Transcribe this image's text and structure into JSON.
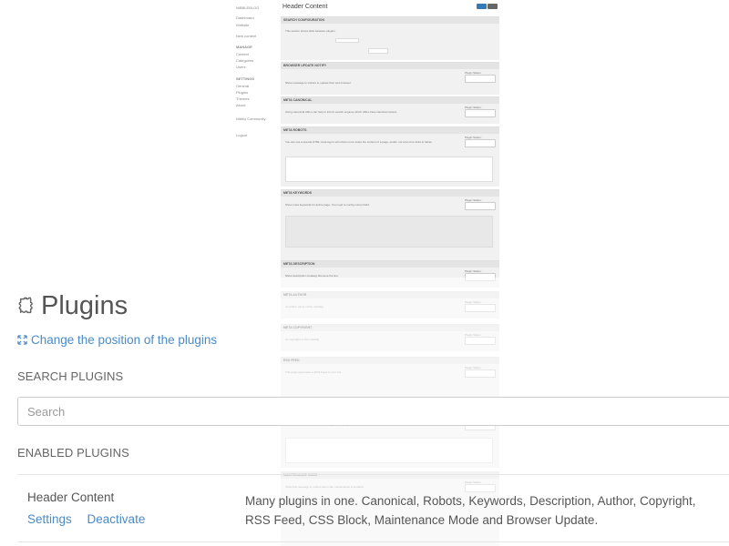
{
  "background": {
    "sidebar": {
      "brand": "NIBBLEBLOG",
      "items": [
        "Dashboard",
        "Website",
        "New content"
      ],
      "manage_label": "MANAGE",
      "manage_items": [
        "Content",
        "Categories",
        "Users"
      ],
      "settings_label": "SETTINGS",
      "settings_items": [
        "General",
        "Plugins",
        "Themes",
        "About"
      ],
      "extra": "Nibbly Community",
      "logout": "Logout"
    },
    "page": {
      "title": "Header Content",
      "sections": [
        {
          "title": "SEARCH CONFIGURATION",
          "desc": "This section shows links between plugins.",
          "status_label": "",
          "select": ""
        },
        {
          "title": "BROWSER UPDATE NOTIFY",
          "desc": "Show message to visitors to update their web browser.",
          "status_label": "Plugin Status:",
          "select": "Enabled"
        },
        {
          "title": "META CANONICAL",
          "desc": "Using canonical URLs can help to inform search engines which URLs have identical content.",
          "status_label": "Plugin Status:",
          "select": "Enabled"
        },
        {
          "title": "META ROBOTS",
          "desc": "You can use a special HTML meta tag to tell robots not to index the content of a page, and/or not scan it for links to follow.",
          "status_label": "Plugin Status:",
          "select": "Enabled"
        },
        {
          "title": "META KEYWORDS",
          "desc": "Show meta keywords for active page. You need to config current field.",
          "status_label": "Plugin Status:",
          "select": "Enabled"
        },
        {
          "title": "META DESCRIPTION",
          "desc": "Show description metatag. Remove the line",
          "status_label": "Plugin Status:",
          "select": "Enabled"
        },
        {
          "title": "META AUTHOR",
          "desc": "An author name of this metatag",
          "status_label": "Plugin Status:",
          "select": "Enabled"
        },
        {
          "title": "META COPYRIGHT",
          "desc": "An copyright of this metatag",
          "status_label": "Plugin Status:",
          "select": "Enabled"
        },
        {
          "title": "RSS FEED",
          "desc": "This plugin generates a RSS Feed of your site.",
          "status_label": "Plugin Status:",
          "select": "Enabled"
        },
        {
          "title": "CSS BLOCK",
          "desc": "Show this css code before html closing the head tag.",
          "status_label": "Plugin Status:",
          "select": "Enabled"
        },
        {
          "title": "MAINTENANCE MODE",
          "desc": "Show this message to visitors when site maintenance is enabled.",
          "status_label": "Plugin Status:",
          "select": "Enabled"
        }
      ]
    }
  },
  "plugins_page": {
    "title": "Plugins",
    "change_position": "Change the position of the plugins",
    "search_heading": "SEARCH PLUGINS",
    "search_placeholder": "Search",
    "enabled_heading": "ENABLED PLUGINS",
    "enabled_plugins": [
      {
        "name": "Header Content",
        "settings_label": "Settings",
        "deactivate_label": "Deactivate",
        "description": "Many plugins in one. Canonical, Robots, Keywords, Description, Author, Copyright, RSS Feed, CSS Block, Maintenance Mode and Browser Update."
      }
    ]
  },
  "colors": {
    "link": "#4a8ac6",
    "text": "#555555",
    "save_button": "#337ab7"
  }
}
